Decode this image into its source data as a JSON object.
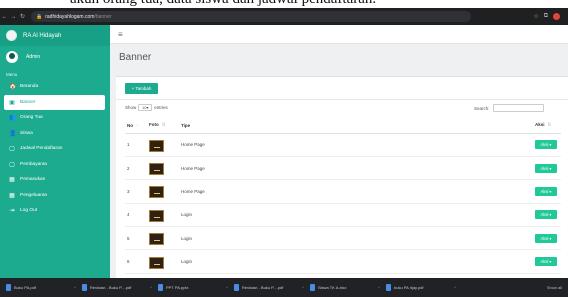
{
  "caption_fragment": "akun orang tua, data siswa dan jadwal pendaftaran.",
  "browser": {
    "url_host": "radhidayahlogam.com",
    "url_path": "/banner"
  },
  "sidebar": {
    "brand": "RA Al Hidayah",
    "user": "Admin",
    "menu_header": "Menu",
    "items": [
      {
        "label": "Beranda",
        "icon": "home-icon",
        "glyph": "🏠"
      },
      {
        "label": "Banner",
        "icon": "image-icon",
        "glyph": "▣"
      },
      {
        "label": "Orang Tua",
        "icon": "users-icon",
        "glyph": "👥"
      },
      {
        "label": "Siswa",
        "icon": "students-icon",
        "glyph": "👤"
      },
      {
        "label": "Jadwal Pendaftaran",
        "icon": "calendar-icon",
        "glyph": "▢"
      },
      {
        "label": "Pembayaran",
        "icon": "payment-icon",
        "glyph": "▢"
      },
      {
        "label": "Pemasukan",
        "icon": "income-icon",
        "glyph": "▦"
      },
      {
        "label": "Pengeluaran",
        "icon": "expense-icon",
        "glyph": "▦"
      },
      {
        "label": "Log Out",
        "icon": "logout-icon",
        "glyph": "⇥"
      }
    ],
    "active_index": 1
  },
  "page": {
    "title": "Banner"
  },
  "toolbar": {
    "add_label": "Tambah"
  },
  "table": {
    "show_label": "Show",
    "show_value": "10",
    "entries_label": "entries",
    "search_label": "Search:",
    "columns": [
      "No",
      "Foto",
      "Tipe",
      "Aksi"
    ],
    "rows": [
      {
        "no": "1",
        "tipe": "Home Page",
        "aksi": "Aksi"
      },
      {
        "no": "2",
        "tipe": "Home Page",
        "aksi": "Aksi"
      },
      {
        "no": "3",
        "tipe": "Home Page",
        "aksi": "Aksi"
      },
      {
        "no": "4",
        "tipe": "Login",
        "aksi": "Aksi"
      },
      {
        "no": "5",
        "tipe": "Login",
        "aksi": "Aksi"
      },
      {
        "no": "6",
        "tipe": "Login",
        "aksi": "Aksi"
      }
    ]
  },
  "downloads": [
    {
      "name": "Buku PA.pdf"
    },
    {
      "name": "Revisian - Buku P....pdf"
    },
    {
      "name": "PPT PA.pptx"
    },
    {
      "name": "Revisian - Buku P....pdf"
    },
    {
      "name": "Siswa TK A.xlsx"
    },
    {
      "name": "buku PA rijay.pdf"
    }
  ],
  "show_all": "Show all",
  "colors": {
    "sidebar": "#1cab8f",
    "accent": "#20c997"
  }
}
